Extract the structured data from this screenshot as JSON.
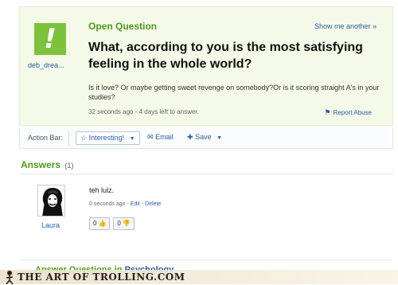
{
  "question": {
    "status_label": "Open Question",
    "show_more": "Show me another »",
    "asker": "deb_drea...",
    "title": "What, according to you is the most satisfying feeling in the whole world?",
    "details": "Is it love? Or maybe getting sweet revenge on somebody?Or is it scoring straight A's in your studies?",
    "meta": "32 seconds ago - 4 days left to answer.",
    "report": "Report Abuse",
    "avatar_icon": "yahoo-answers-avatar-icon",
    "accent_color": "#4f9a1c"
  },
  "action_bar": {
    "label": "Action Bar:",
    "interesting": "Interesting!",
    "email": "Email",
    "save": "Save"
  },
  "answers": {
    "heading": "Answers",
    "count": "(1)",
    "items": [
      {
        "author": "Laura",
        "text": "teh lulz.",
        "time": "0 seconds ago",
        "edit": "Edit",
        "delete": "Delete",
        "thumbs_up": "0",
        "thumbs_down": "0"
      }
    ]
  },
  "more": {
    "heading_prefix": "Answer Questions in",
    "category": "Psychology"
  },
  "watermark": {
    "text": "THE ART OF TROLLING.COM"
  }
}
